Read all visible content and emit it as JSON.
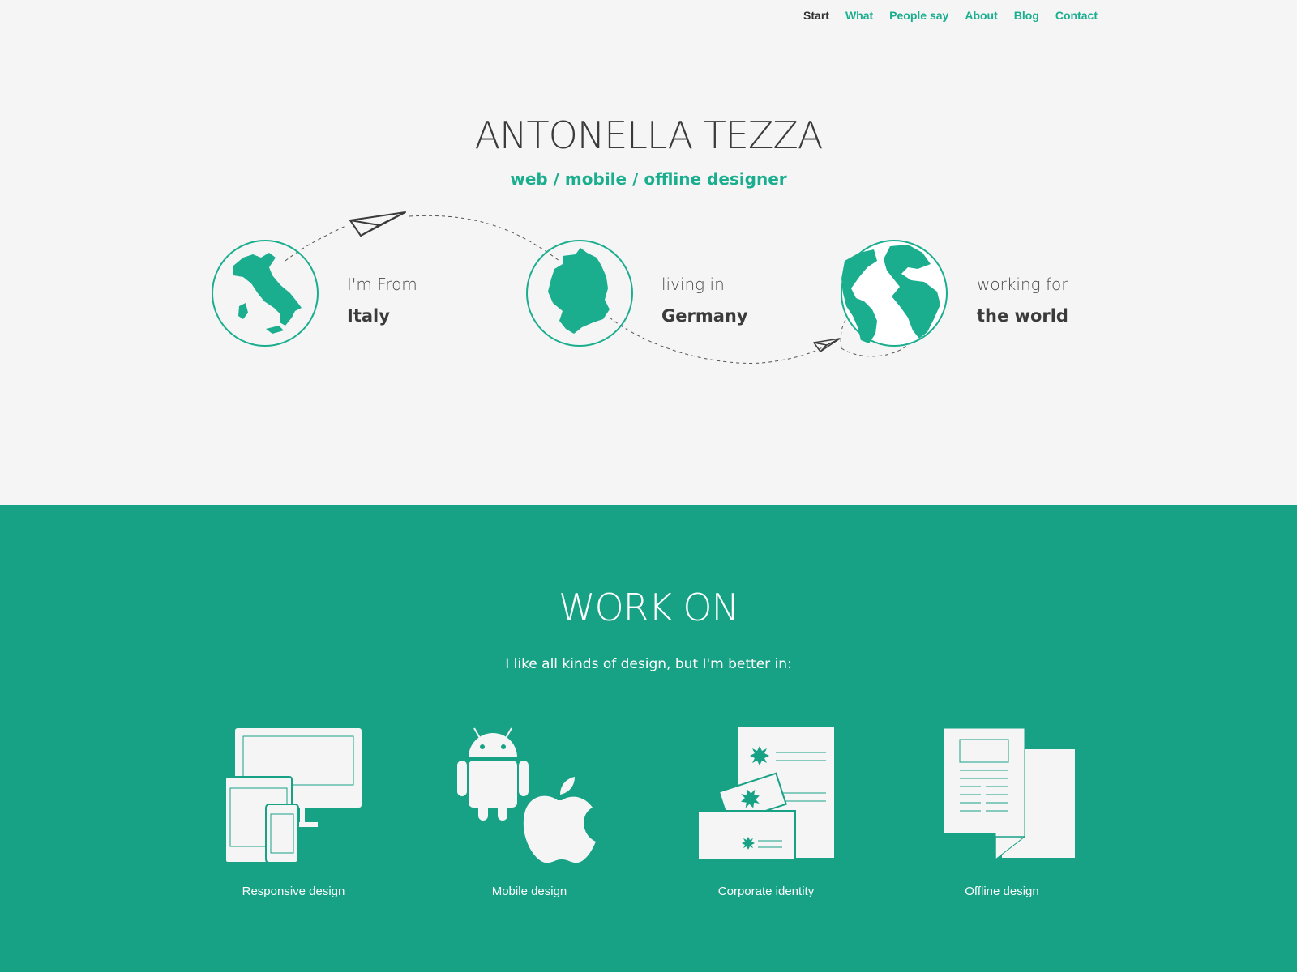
{
  "nav": {
    "items": [
      {
        "label": "Start",
        "active": true
      },
      {
        "label": "What",
        "active": false
      },
      {
        "label": "People say",
        "active": false
      },
      {
        "label": "About",
        "active": false
      },
      {
        "label": "Blog",
        "active": false
      },
      {
        "label": "Contact",
        "active": false
      }
    ]
  },
  "hero": {
    "title": "ANTONELLA TEZZA",
    "subtitle": "web / mobile / offline designer",
    "places": [
      {
        "small": "I'm From",
        "big": "Italy",
        "icon": "italy-map-icon"
      },
      {
        "small": "living in",
        "big": "Germany",
        "icon": "germany-map-icon"
      },
      {
        "small": "working for",
        "big": "the world",
        "icon": "globe-icon"
      }
    ]
  },
  "work": {
    "title": "WORK ON",
    "subtitle": "I like all kinds of design, but I'm better in:",
    "skills": [
      {
        "label": "Responsive design",
        "icon": "responsive-devices-icon"
      },
      {
        "label": "Mobile design",
        "icon": "android-apple-icon"
      },
      {
        "label": "Corporate identity",
        "icon": "corporate-stationery-icon"
      },
      {
        "label": "Offline design",
        "icon": "printed-documents-icon"
      }
    ]
  },
  "colors": {
    "accent": "#1aae8f",
    "section_bg": "#17a185",
    "page_bg": "#f6f5f5",
    "text_dark": "#3b3b3b"
  }
}
